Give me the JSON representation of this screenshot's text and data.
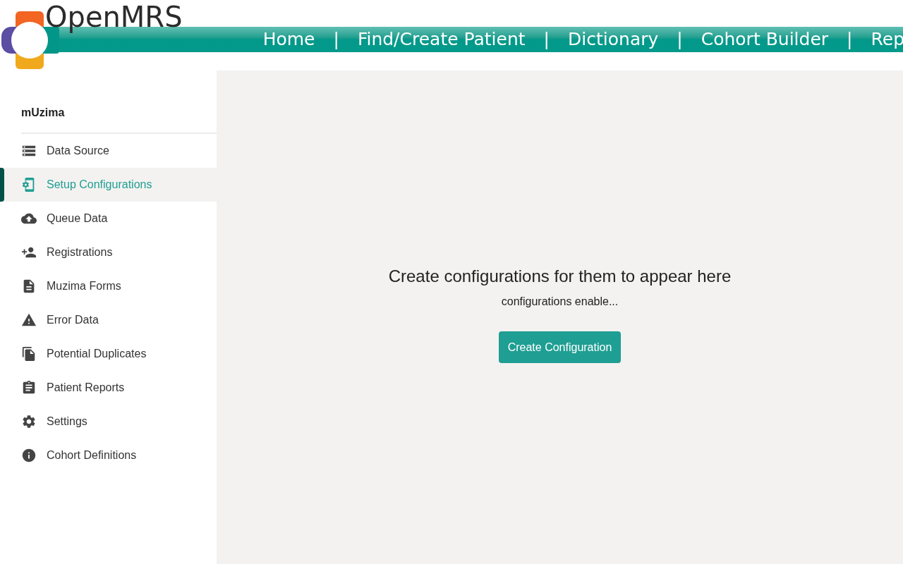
{
  "header": {
    "brand": "OpenMRS",
    "nav": [
      {
        "kind": "link",
        "label": "Home"
      },
      {
        "kind": "separator",
        "label": "|"
      },
      {
        "kind": "link",
        "label": "Find/Create Patient"
      },
      {
        "kind": "separator",
        "label": "|"
      },
      {
        "kind": "link",
        "label": "Dictionary"
      },
      {
        "kind": "separator",
        "label": "|"
      },
      {
        "kind": "link",
        "label": "Cohort Builder"
      },
      {
        "kind": "separator",
        "label": "|"
      },
      {
        "kind": "link",
        "label": "Rep"
      }
    ]
  },
  "sidebar": {
    "title": "mUzima",
    "items": [
      {
        "kind": "server",
        "label": "Data Source",
        "selected": false
      },
      {
        "kind": "phone-setup",
        "label": "Setup Configurations",
        "selected": true
      },
      {
        "kind": "cloud-upload",
        "label": "Queue Data",
        "selected": false
      },
      {
        "kind": "person-add",
        "label": "Registrations",
        "selected": false
      },
      {
        "kind": "document",
        "label": "Muzima Forms",
        "selected": false
      },
      {
        "kind": "warning",
        "label": "Error Data",
        "selected": false
      },
      {
        "kind": "copy",
        "label": "Potential Duplicates",
        "selected": false
      },
      {
        "kind": "clipboard",
        "label": "Patient Reports",
        "selected": false
      },
      {
        "kind": "gear",
        "label": "Settings",
        "selected": false
      },
      {
        "kind": "info",
        "label": "Cohort Definitions",
        "selected": false
      }
    ]
  },
  "main": {
    "heading": "Create configurations for them to appear here",
    "subtext": "configurations enable...",
    "button": "Create Configuration"
  }
}
